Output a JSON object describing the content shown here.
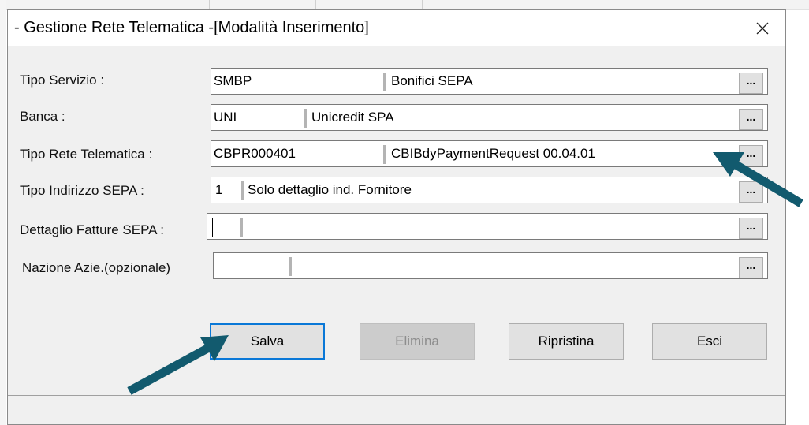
{
  "window": {
    "title": "- Gestione Rete Telematica -[Modalità Inserimento]",
    "close_icon": "close-icon"
  },
  "form": {
    "rows": [
      {
        "label": "Tipo Servizio :",
        "code": "SMBP",
        "description": "Bonifici SEPA"
      },
      {
        "label": "Banca :",
        "code": "UNI",
        "description": "Unicredit SPA"
      },
      {
        "label": "Tipo Rete Telematica :",
        "code": "CBPR000401",
        "description": "CBIBdyPaymentRequest 00.04.01"
      },
      {
        "label": "Tipo Indirizzo SEPA :",
        "code": "1",
        "description": "Solo dettaglio ind. Fornitore"
      },
      {
        "label": "Dettaglio Fatture SEPA :",
        "code": "",
        "description": ""
      },
      {
        "label": "Nazione Azie.(opzionale)",
        "code": "",
        "description": ""
      }
    ],
    "lookup_label": "..."
  },
  "buttons": {
    "save": "Salva",
    "delete": "Elimina",
    "reset": "Ripristina",
    "exit": "Esci"
  },
  "annotations": {
    "arrow_color": "#125a6e"
  }
}
